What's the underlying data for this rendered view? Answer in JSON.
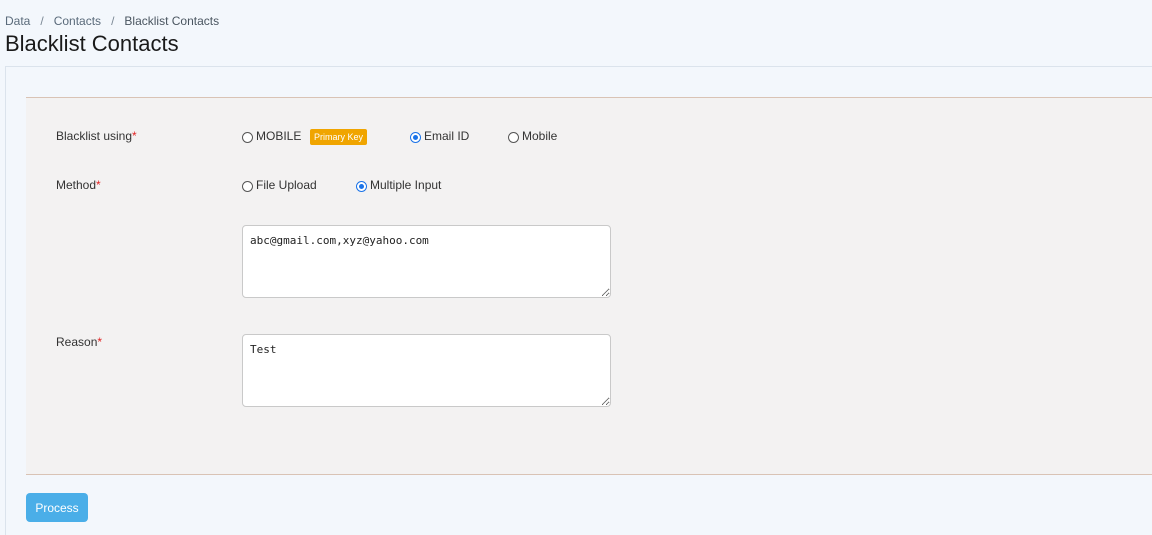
{
  "breadcrumb": {
    "items": [
      "Data",
      "Contacts",
      "Blacklist Contacts"
    ],
    "separator": "/"
  },
  "page": {
    "title": "Blacklist Contacts"
  },
  "form": {
    "blacklist_using": {
      "label": "Blacklist using",
      "required_mark": "*",
      "options": [
        "MOBILE",
        "Email ID",
        "Mobile"
      ],
      "selected": "Email ID",
      "badge": "Primary Key"
    },
    "method": {
      "label": "Method",
      "required_mark": "*",
      "options": [
        "File Upload",
        "Multiple Input"
      ],
      "selected": "Multiple Input"
    },
    "multiple_input": {
      "value": "abc@gmail.com,xyz@yahoo.com"
    },
    "reason": {
      "label": "Reason",
      "required_mark": "*",
      "value": "Test"
    }
  },
  "actions": {
    "process_label": "Process"
  },
  "colors": {
    "accent": "#1a73e8",
    "button": "#4aaee8",
    "badge": "#f0a500",
    "required": "#e02424"
  }
}
